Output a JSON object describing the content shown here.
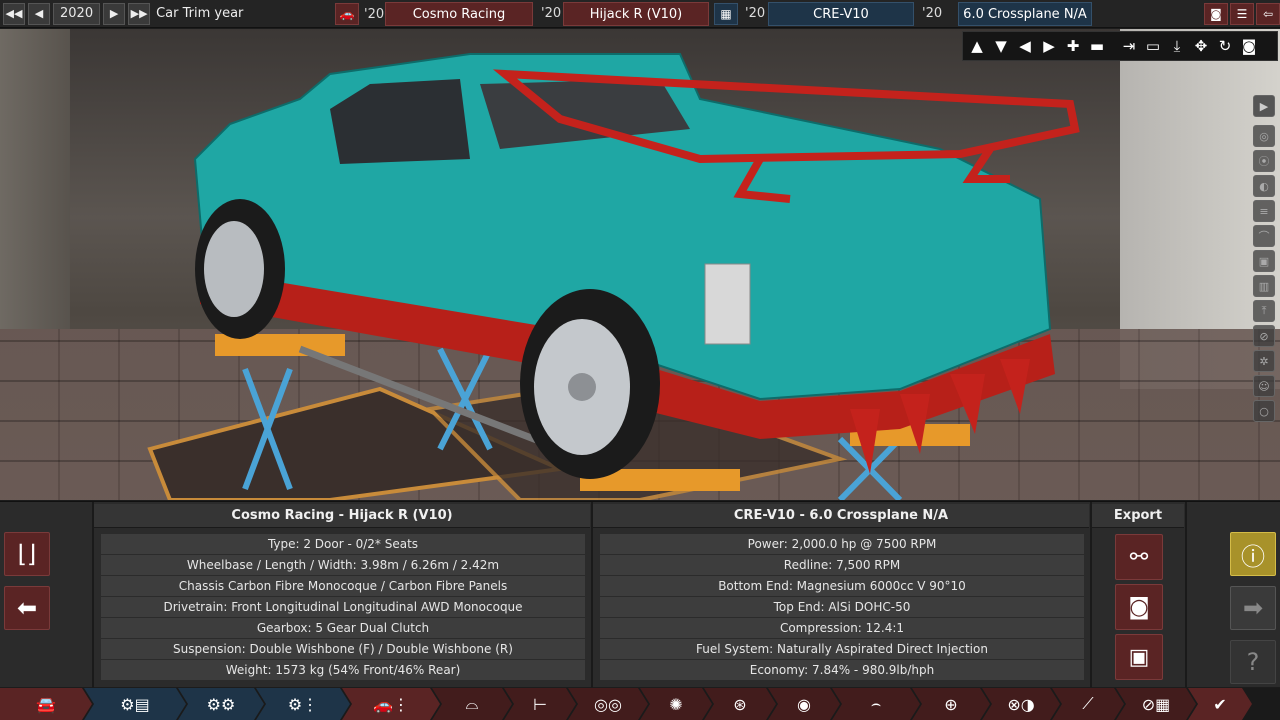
{
  "topbar": {
    "year": "2020",
    "trim_label": "Car Trim year",
    "model_year": "'20",
    "family_year": "'20",
    "engine_year": "'20",
    "variant_year": "'20",
    "car_model": "Cosmo Racing",
    "car_trim": "Hijack R (V10)",
    "engine_family": "CRE-V10",
    "engine_variant": "6.0 Crossplane N/A",
    "icons": [
      "rewind-icon",
      "prev-icon",
      "next-icon",
      "fast-forward-icon",
      "car-icon",
      "engine-icon",
      "camera-icon",
      "list-icon",
      "back-icon"
    ]
  },
  "car_info": {
    "title": "Cosmo Racing - Hijack R (V10)",
    "rows": [
      "Type: 2 Door - 0/2* Seats",
      "Wheelbase / Length / Width: 3.98m / 6.26m / 2.42m",
      "Chassis Carbon Fibre Monocoque / Carbon Fibre Panels",
      "Drivetrain: Front Longitudinal Longitudinal AWD Monocoque",
      "Gearbox: 5 Gear Dual Clutch",
      "Suspension: Double Wishbone (F) / Double Wishbone (R)",
      "Weight: 1573 kg (54% Front/46% Rear)"
    ]
  },
  "engine_info": {
    "title": "CRE-V10 - 6.0 Crossplane N/A",
    "rows": [
      "Power: 2,000.0 hp @ 7500 RPM",
      "Redline:  7,500 RPM",
      "Bottom End: Magnesium 6000cc V 90°10",
      "Top End: AlSi DOHC-50",
      "Compression: 12.4:1",
      "Fuel System: Naturally Aspirated Direct Injection",
      "Economy: 7.84% - 980.9lb/hph"
    ]
  },
  "export": {
    "title": "Export"
  },
  "colors": {
    "accent_red": "#5a2424",
    "accent_blue": "#1e3448",
    "warning": "#a8922a",
    "car_body": "#1fa7a4",
    "car_trim": "#c0201b"
  }
}
